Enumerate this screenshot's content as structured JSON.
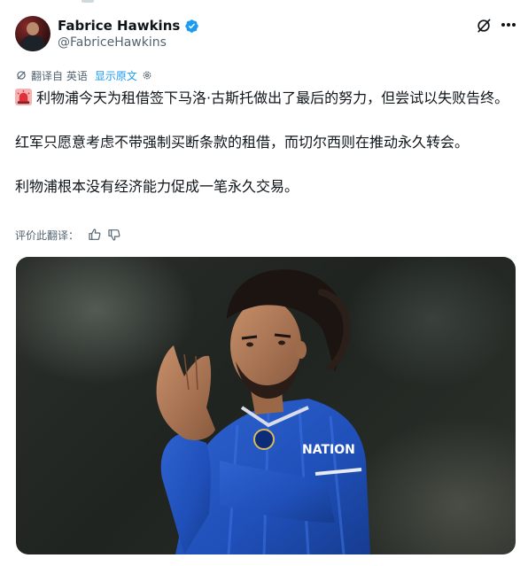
{
  "author": {
    "display_name": "Fabrice Hawkins",
    "handle": "@FabriceHawkins"
  },
  "translation": {
    "label": "翻译自 英语",
    "show_original": "显示原文"
  },
  "tweet": {
    "para1": "利物浦今天为租借签下马洛·古斯托做出了最后的努力，但尝试以失败告终。",
    "para2": "红军只愿意考虑不带强制买断条款的租借，而切尔西则在推动永久转会。",
    "para3": "利物浦根本没有经济能力促成一笔永久交易。"
  },
  "rate_translation": {
    "label": "评价此翻译："
  },
  "media": {
    "kit_sponsor": "NATION"
  },
  "colors": {
    "accent": "#1d9bf0",
    "text": "#0f1419",
    "secondary": "#536471",
    "chelsea_blue": "#1f4fb8"
  },
  "icons": {
    "verified": "verified-badge-icon",
    "grok": "grok-icon",
    "more": "more-icon",
    "translate": "translate-icon",
    "settings": "gear-icon",
    "siren": "siren-emoji-icon",
    "thumbs_up": "thumbs-up-icon",
    "thumbs_down": "thumbs-down-icon"
  }
}
